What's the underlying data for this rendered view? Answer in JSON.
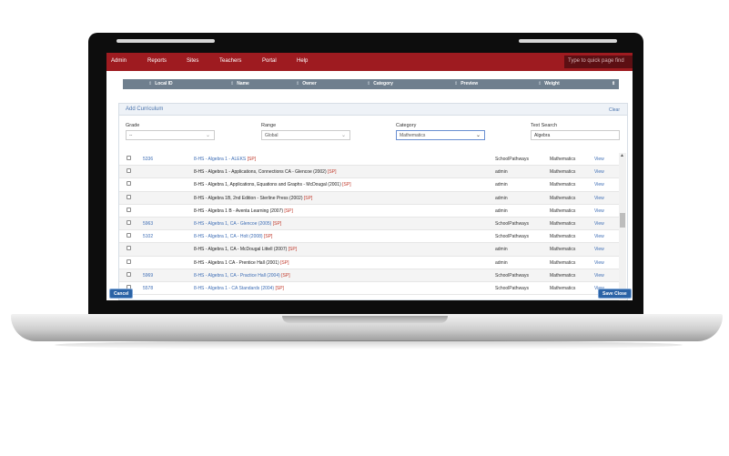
{
  "nav": {
    "items": [
      "Admin",
      "Reports",
      "Sites",
      "Teachers",
      "Portal",
      "Help"
    ],
    "quick_search_placeholder": "Type to quick page find"
  },
  "table_header": [
    "Local ID",
    "Name",
    "Owner",
    "Category",
    "Preview",
    "Weight"
  ],
  "panel": {
    "title": "Add Curriculum",
    "clear_label": "Clear",
    "filters": {
      "grade_label": "Grade",
      "grade_value": "--",
      "range_label": "Range",
      "range_value": "Global",
      "category_label": "Category",
      "category_value": "Mathematics",
      "text_search_label": "Text Search",
      "text_search_value": "Algebra"
    }
  },
  "rows": [
    {
      "id": "5336",
      "name": "8-HS - Algebra 1 - ALEKS",
      "sp": "[SP]",
      "owner": "SchoolPathways",
      "category": "Mathematics",
      "view": "View"
    },
    {
      "id": "",
      "name": "8-HS - Algebra 1 - Applications, Connections CA - Glencoe (2002)",
      "sp": "[SP]",
      "owner": "admin",
      "category": "Mathematics",
      "view": "View"
    },
    {
      "id": "",
      "name": "8-HS - Algebra 1, Applications, Equations and Graphs - McDougal (2001)",
      "sp": "[SP]",
      "owner": "admin",
      "category": "Mathematics",
      "view": "View"
    },
    {
      "id": "",
      "name": "8-HS - Algebra 1B, 2nd Edition - Sterline Press (2002)",
      "sp": "[SP]",
      "owner": "admin",
      "category": "Mathematics",
      "view": "View"
    },
    {
      "id": "",
      "name": "8-HS - Algebra 1 B - Aventa Learning (2007)",
      "sp": "[SP]",
      "owner": "admin",
      "category": "Mathematics",
      "view": "View"
    },
    {
      "id": "5963",
      "name": "8-HS - Algebra 1, CA - Glencoe (2005)",
      "sp": "[SP]",
      "owner": "SchoolPathways",
      "category": "Mathematics",
      "view": "View"
    },
    {
      "id": "5102",
      "name": "8-HS - Algebra 1, CA - Holt (2008)",
      "sp": "[SP]",
      "owner": "SchoolPathways",
      "category": "Mathematics",
      "view": "View"
    },
    {
      "id": "",
      "name": "8-HS - Algebra 1, CA - McDougal Littell (2007)",
      "sp": "[SP]",
      "owner": "admin",
      "category": "Mathematics",
      "view": "View"
    },
    {
      "id": "",
      "name": "8-HS - Algebra 1 CA - Prentice Hall (2001)",
      "sp": "[SP]",
      "owner": "admin",
      "category": "Mathematics",
      "view": "View"
    },
    {
      "id": "5969",
      "name": "8-HS - Algebra 1, CA - Practice Hall (2004)",
      "sp": "[SP]",
      "owner": "SchoolPathways",
      "category": "Mathematics",
      "view": "View"
    },
    {
      "id": "5578",
      "name": "8-HS - Algebra 1 - CA Standards (2004)",
      "sp": "[SP]",
      "owner": "SchoolPathways",
      "category": "Mathematics",
      "view": "View"
    }
  ],
  "buttons": {
    "cancel": "Cancel",
    "save_close": "Save Close"
  },
  "colors": {
    "nav_red": "#9e1b20",
    "header_slate": "#6f7f8e",
    "link_blue": "#3d6db5",
    "button_blue": "#2b63a6"
  }
}
